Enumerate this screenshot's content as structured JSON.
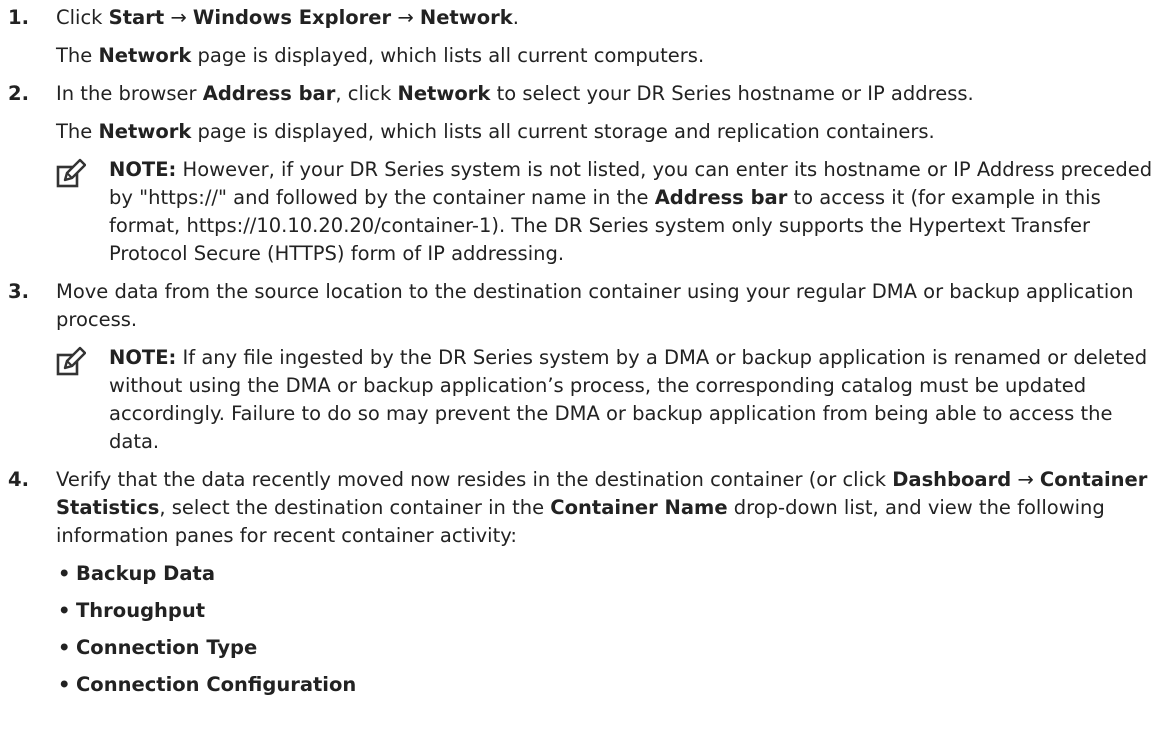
{
  "steps": [
    {
      "number": "1.",
      "l1_pre": "Click ",
      "l1_b1": "Start",
      "l1_a1": " → ",
      "l1_b2": "Windows Explorer",
      "l1_a2": " → ",
      "l1_b3": "Network",
      "l1_post": ".",
      "l2_pre": "The ",
      "l2_b": "Network",
      "l2_post": " page is displayed, which lists all current computers."
    },
    {
      "number": "2.",
      "l1_pre": "In the browser ",
      "l1_b1": "Address bar",
      "l1_mid": ", click ",
      "l1_b2": "Network",
      "l1_post": " to select your DR Series hostname or IP address.",
      "l2_pre": "The ",
      "l2_b": "Network",
      "l2_post": " page is displayed, which lists all current storage and replication containers.",
      "note": {
        "label": "NOTE:",
        "pre": " However, if your DR Series system is not listed, you can enter its hostname or IP Address preceded by \"https://\" and followed by the container name in the ",
        "b": "Address bar",
        "post": " to access it (for example in this format, https://10.10.20.20/container-1). The DR Series system only supports the Hypertext Transfer Protocol Secure (HTTPS) form of IP addressing."
      }
    },
    {
      "number": "3.",
      "text": "Move data from the source location to the destination container using your regular DMA or backup application process.",
      "note": {
        "label": "NOTE:",
        "text": " If any file ingested by the DR Series system by a DMA or backup application is renamed or deleted without using the DMA or backup application’s process, the corresponding catalog must be updated accordingly. Failure to do so may prevent the DMA or backup application from being able to access the data."
      }
    },
    {
      "number": "4.",
      "pre": "Verify that the data recently moved now resides in the destination container (or click ",
      "b1": "Dashboard",
      "a1": " → ",
      "b2": "Container Statistics",
      "mid": ", select the destination container in the ",
      "b3": "Container Name",
      "post": " drop-down list, and view the following information panes for recent container activity:",
      "bullets": [
        "Backup Data",
        "Throughput",
        "Connection Type",
        "Connection Configuration"
      ]
    }
  ],
  "icons": {
    "note": "pencil-note-icon"
  }
}
